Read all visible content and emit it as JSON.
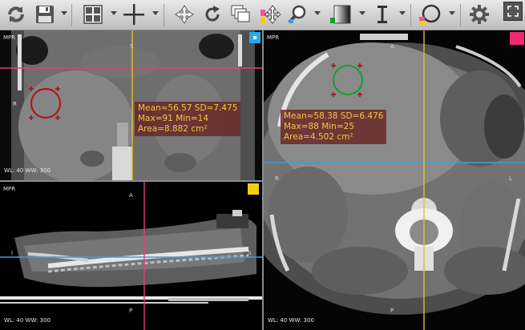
{
  "toolbar": {
    "buttons": [
      {
        "name": "sync-icon"
      },
      {
        "name": "save-icon"
      },
      {
        "name": "layout-grid-icon"
      },
      {
        "name": "crosshair-icon"
      },
      {
        "name": "pan-icon"
      },
      {
        "name": "rotate-icon"
      },
      {
        "name": "stack-icon"
      },
      {
        "name": "move-icon"
      },
      {
        "name": "zoom-icon"
      },
      {
        "name": "window-level-icon"
      },
      {
        "name": "measure-length-icon"
      },
      {
        "name": "roi-ellipse-icon"
      },
      {
        "name": "settings-gear-icon"
      },
      {
        "name": "fullscreen-icon"
      }
    ]
  },
  "viewports": {
    "coronal": {
      "label": "MPR",
      "top": "S",
      "bottom": "I",
      "left": "R",
      "wl": "WL: 40 WW: 300",
      "corner_color": "#29a9e8",
      "roi": {
        "mean": "Mean≈56.57 SD=7.475",
        "maxmin": "Max=91 Min=14",
        "area": "Area=8.882 cm²",
        "color": "#b01818"
      }
    },
    "sagittal": {
      "label": "MPR",
      "top": "A",
      "bottom": "P",
      "left": "I",
      "right": "S",
      "wl": "WL: 40 WW: 300",
      "corner_color": "#f3cf10"
    },
    "axial": {
      "label": "MPR",
      "top": "A",
      "bottom": "P",
      "left": "R",
      "right": "L",
      "wl": "WL: 40 WW: 300",
      "corner_color": "#ef2a73",
      "roi": {
        "mean": "Mean≈58.38 SD=6.476",
        "maxmin": "Max=88 Min=25",
        "area": "Area=4.502 cm²",
        "color": "#12a028"
      }
    }
  },
  "colors": {
    "crosshair_blue": "#3aa0e0",
    "crosshair_pink": "#e0407a",
    "crosshair_yellow": "#e6c020",
    "stats_text": "#f5c542"
  }
}
